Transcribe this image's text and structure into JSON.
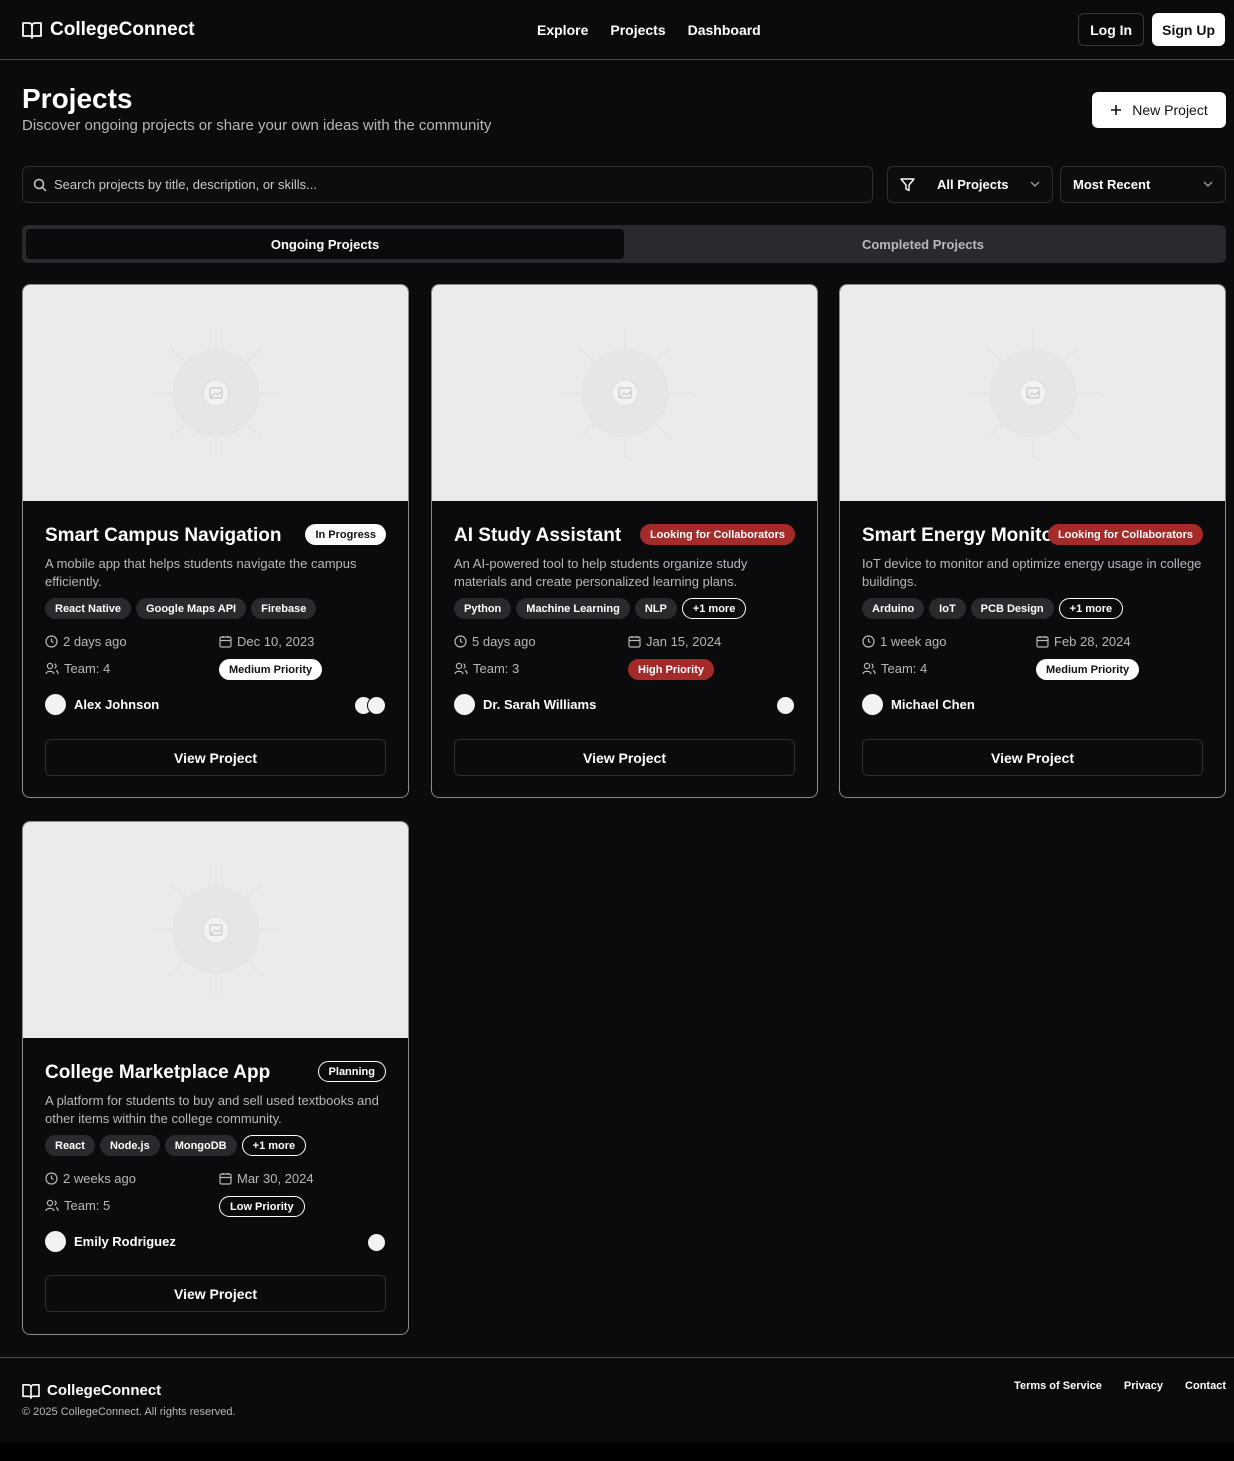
{
  "app": {
    "name": "CollegeConnect"
  },
  "nav": {
    "explore": "Explore",
    "projects": "Projects",
    "dashboard": "Dashboard"
  },
  "auth": {
    "login": "Log In",
    "signup": "Sign Up"
  },
  "page": {
    "title": "Projects",
    "subtitle": "Discover ongoing projects or share your own ideas with the community",
    "new_button": "New Project"
  },
  "search": {
    "placeholder": "Search projects by title, description, or skills..."
  },
  "filters": {
    "category": "All Projects",
    "sort": "Most Recent"
  },
  "tabs": {
    "ongoing": "Ongoing Projects",
    "completed": "Completed Projects"
  },
  "projects": [
    {
      "title": "Smart Campus Navigation",
      "status": "In Progress",
      "description": "A mobile app that helps students navigate the campus efficiently.",
      "tags": [
        "React Native",
        "Google Maps API",
        "Firebase"
      ],
      "posted": "2 days ago",
      "deadline": "Dec 10, 2023",
      "team": "Team: 4",
      "priority": "Medium Priority",
      "author": "Alex Johnson",
      "action": "View Project"
    },
    {
      "title": "AI Study Assistant",
      "status": "Looking for Collaborators",
      "description": "An AI-powered tool to help students organize study materials and create personalized learning plans.",
      "tags": [
        "Python",
        "Machine Learning",
        "NLP",
        "+1 more"
      ],
      "posted": "5 days ago",
      "deadline": "Jan 15, 2024",
      "team": "Team: 3",
      "priority": "High Priority",
      "author": "Dr. Sarah Williams",
      "action": "View Project"
    },
    {
      "title": "Smart Energy Monitor",
      "status": "Looking for Collaborators",
      "description": "IoT device to monitor and optimize energy usage in college buildings.",
      "tags": [
        "Arduino",
        "IoT",
        "PCB Design",
        "+1 more"
      ],
      "posted": "1 week ago",
      "deadline": "Feb 28, 2024",
      "team": "Team: 4",
      "priority": "Medium Priority",
      "author": "Michael Chen",
      "action": "View Project"
    },
    {
      "title": "College Marketplace App",
      "status": "Planning",
      "description": "A platform for students to buy and sell used textbooks and other items within the college community.",
      "tags": [
        "React",
        "Node.js",
        "MongoDB",
        "+1 more"
      ],
      "posted": "2 weeks ago",
      "deadline": "Mar 30, 2024",
      "team": "Team: 5",
      "priority": "Low Priority",
      "author": "Emily Rodriguez",
      "action": "View Project"
    }
  ],
  "footer": {
    "brand": "CollegeConnect",
    "copyright": "© 2025 CollegeConnect. All rights reserved.",
    "links": {
      "terms": "Terms of Service",
      "privacy": "Privacy",
      "contact": "Contact"
    }
  },
  "colors": {
    "background": "#0b0b0d",
    "accent_red": "#a52a2a",
    "muted_chip": "#2a2a2e"
  }
}
